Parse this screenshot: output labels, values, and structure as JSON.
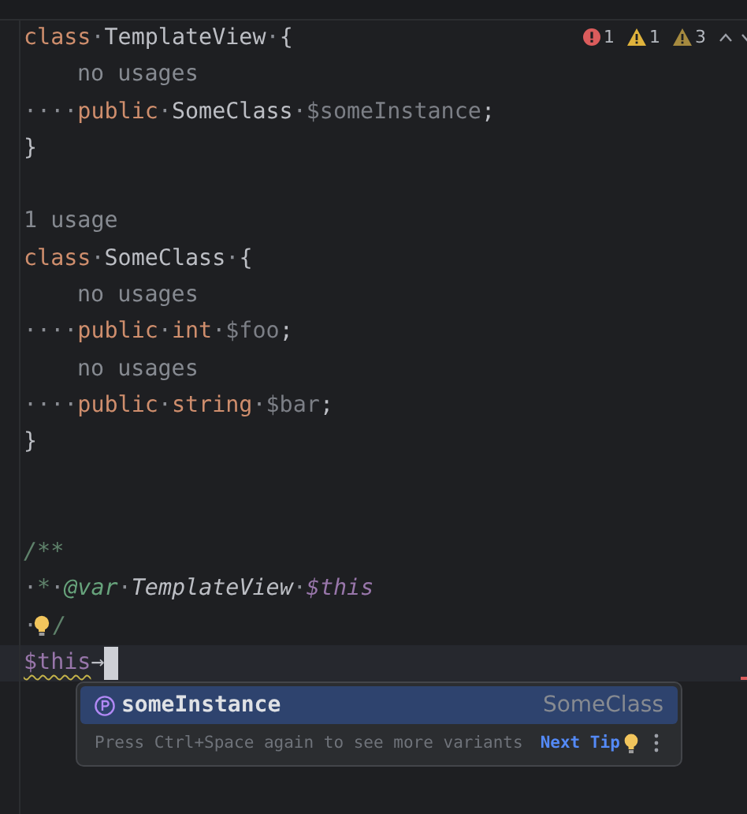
{
  "inspections": [
    {
      "kind": "error",
      "count": "1"
    },
    {
      "kind": "warning",
      "count": "1"
    },
    {
      "kind": "weak",
      "count": "3"
    }
  ],
  "lines": [
    {
      "kind": "code",
      "tokens": [
        {
          "kind": "keyword",
          "text": "class"
        },
        {
          "kind": "ws",
          "text": "·"
        },
        {
          "kind": "plain",
          "text": "TemplateView"
        },
        {
          "kind": "ws",
          "text": "·"
        },
        {
          "kind": "plain",
          "text": "{"
        }
      ]
    },
    {
      "kind": "member_hint",
      "text": "no usages"
    },
    {
      "kind": "code",
      "tokens": [
        {
          "kind": "ws",
          "text": "····"
        },
        {
          "kind": "keyword",
          "text": "public"
        },
        {
          "kind": "ws",
          "text": "·"
        },
        {
          "kind": "plain",
          "text": "SomeClass"
        },
        {
          "kind": "ws",
          "text": "·"
        },
        {
          "kind": "unused",
          "text": "$someInstance"
        },
        {
          "kind": "plain",
          "text": ";"
        }
      ]
    },
    {
      "kind": "code",
      "tokens": [
        {
          "kind": "plain",
          "text": "}"
        }
      ]
    },
    {
      "kind": "blank"
    },
    {
      "kind": "class_hint",
      "text": "1 usage"
    },
    {
      "kind": "code",
      "tokens": [
        {
          "kind": "keyword",
          "text": "class"
        },
        {
          "kind": "ws",
          "text": "·"
        },
        {
          "kind": "plain",
          "text": "SomeClass"
        },
        {
          "kind": "ws",
          "text": "·"
        },
        {
          "kind": "plain",
          "text": "{"
        }
      ]
    },
    {
      "kind": "member_hint",
      "text": "no usages"
    },
    {
      "kind": "code",
      "tokens": [
        {
          "kind": "ws",
          "text": "····"
        },
        {
          "kind": "keyword",
          "text": "public"
        },
        {
          "kind": "ws",
          "text": "·"
        },
        {
          "kind": "keyword",
          "text": "int"
        },
        {
          "kind": "ws",
          "text": "·"
        },
        {
          "kind": "unused",
          "text": "$foo"
        },
        {
          "kind": "plain",
          "text": ";"
        }
      ]
    },
    {
      "kind": "member_hint",
      "text": "no usages"
    },
    {
      "kind": "code",
      "tokens": [
        {
          "kind": "ws",
          "text": "····"
        },
        {
          "kind": "keyword",
          "text": "public"
        },
        {
          "kind": "ws",
          "text": "·"
        },
        {
          "kind": "keyword",
          "text": "string"
        },
        {
          "kind": "ws",
          "text": "·"
        },
        {
          "kind": "unused",
          "text": "$bar"
        },
        {
          "kind": "plain",
          "text": ";"
        }
      ]
    },
    {
      "kind": "code",
      "tokens": [
        {
          "kind": "plain",
          "text": "}"
        }
      ]
    },
    {
      "kind": "blank"
    },
    {
      "kind": "blank"
    },
    {
      "kind": "code",
      "tokens": [
        {
          "kind": "doc",
          "text": "/**"
        }
      ]
    },
    {
      "kind": "code",
      "tokens": [
        {
          "kind": "ws",
          "text": "·"
        },
        {
          "kind": "doc",
          "text": "*"
        },
        {
          "kind": "ws",
          "text": "·"
        },
        {
          "kind": "doctag",
          "text": "@var"
        },
        {
          "kind": "ws",
          "text": "·"
        },
        {
          "kind": "doctype",
          "text": "TemplateView"
        },
        {
          "kind": "ws",
          "text": "·"
        },
        {
          "kind": "docvar",
          "text": "$this"
        }
      ]
    },
    {
      "kind": "code",
      "bulb": true,
      "tokens": [
        {
          "kind": "ws",
          "text": "·"
        },
        {
          "kind": "doc",
          "text": "/"
        }
      ]
    },
    {
      "kind": "code",
      "current": true,
      "tokens": [
        {
          "kind": "var",
          "underlined": true,
          "text": "$this"
        },
        {
          "kind": "op",
          "text": "→"
        }
      ]
    }
  ],
  "completion": {
    "items": [
      {
        "name": "someInstance",
        "type": "SomeClass",
        "selected": true
      }
    ],
    "hint": "Press Ctrl+Space again to see more variants",
    "link": "Next Tip"
  }
}
